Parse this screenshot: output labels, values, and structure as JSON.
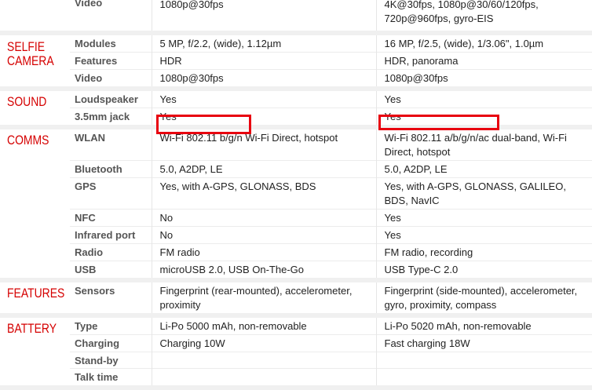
{
  "video_top": {
    "label": "Video",
    "phone1": "1080p@30fps",
    "phone2": "4K@30fps, 1080p@30/60/120fps, 720p@960fps, gyro-EIS"
  },
  "selfie": {
    "title": "SELFIE\nCAMERA",
    "rows": [
      {
        "label": "Modules",
        "phone1": "5 MP, f/2.2, (wide), 1.12µm",
        "phone2": "16 MP, f/2.5, (wide), 1/3.06\", 1.0µm"
      },
      {
        "label": "Features",
        "phone1": "HDR",
        "phone2": "HDR, panorama"
      },
      {
        "label": "Video",
        "phone1": "1080p@30fps",
        "phone2": "1080p@30fps"
      }
    ]
  },
  "sound": {
    "title": "SOUND",
    "rows": [
      {
        "label": "Loudspeaker",
        "phone1": "Yes",
        "phone2": "Yes"
      },
      {
        "label": "3.5mm jack",
        "phone1": "Yes",
        "phone2": "Yes"
      }
    ]
  },
  "comms": {
    "title": "COMMS",
    "wlan": {
      "label": "WLAN",
      "phone1_highlight": "Wi-Fi 802.11 b/g/n",
      "phone1_rest": " Wi-Fi Direct, hotspot",
      "phone2_highlight": "Wi-Fi 802.11 a/b/g/n/ac",
      "phone2_rest": " dual-band, Wi-Fi Direct, hotspot"
    },
    "rows": [
      {
        "label": "Bluetooth",
        "phone1": "5.0, A2DP, LE",
        "phone2": "5.0, A2DP, LE"
      },
      {
        "label": "GPS",
        "phone1": "Yes, with A-GPS, GLONASS, BDS",
        "phone2": "Yes, with A-GPS, GLONASS, GALILEO, BDS, NavIC"
      },
      {
        "label": "NFC",
        "phone1": "No",
        "phone2": "Yes"
      },
      {
        "label": "Infrared port",
        "phone1": "No",
        "phone2": "Yes"
      },
      {
        "label": "Radio",
        "phone1": "FM radio",
        "phone2": "FM radio, recording"
      },
      {
        "label": "USB",
        "phone1": "microUSB 2.0, USB On-The-Go",
        "phone2": "USB Type-C 2.0"
      }
    ]
  },
  "features": {
    "title": "FEATURES",
    "rows": [
      {
        "label": "Sensors",
        "phone1": "Fingerprint (rear-mounted), accelerometer, proximity",
        "phone2": "Fingerprint (side-mounted), accelerometer, gyro, proximity, compass"
      }
    ]
  },
  "battery": {
    "title": "BATTERY",
    "rows": [
      {
        "label": "Type",
        "phone1": "Li-Po 5000 mAh, non-removable",
        "phone2": "Li-Po 5020 mAh, non-removable"
      },
      {
        "label": "Charging",
        "phone1": "Charging 10W",
        "phone2": "Fast charging 18W"
      },
      {
        "label": "Stand-by",
        "phone1": "",
        "phone2": ""
      },
      {
        "label": "Talk time",
        "phone1": "",
        "phone2": ""
      }
    ]
  },
  "colors": {
    "section_title": "#d50000",
    "highlight_box": "#e8000f",
    "separator": "#f0f0f0"
  }
}
